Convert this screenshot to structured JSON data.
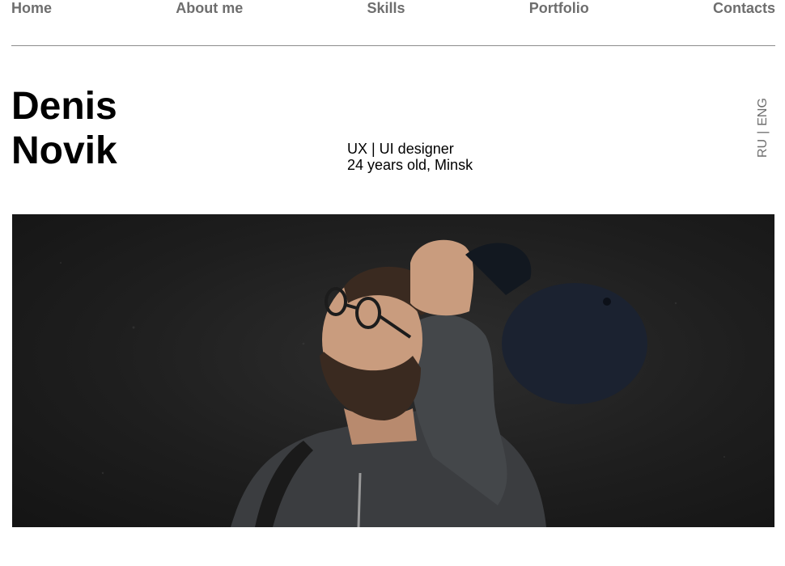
{
  "nav": {
    "items": [
      {
        "label": "Home"
      },
      {
        "label": "About me"
      },
      {
        "label": "Skills"
      },
      {
        "label": "Portfolio"
      },
      {
        "label": "Contacts"
      }
    ]
  },
  "header": {
    "first_name": "Denis",
    "last_name": "Novik",
    "role": "UX | UI designer",
    "details": "24 years old, Minsk"
  },
  "language": {
    "ru": "RU",
    "separator": "|",
    "eng": "ENG"
  },
  "hero": {
    "image": "portrait-photo"
  },
  "colors": {
    "nav_text": "#6e6e6e",
    "divider": "#8c8c8c",
    "text": "#000000",
    "photo_background": "#1e1e1e"
  }
}
